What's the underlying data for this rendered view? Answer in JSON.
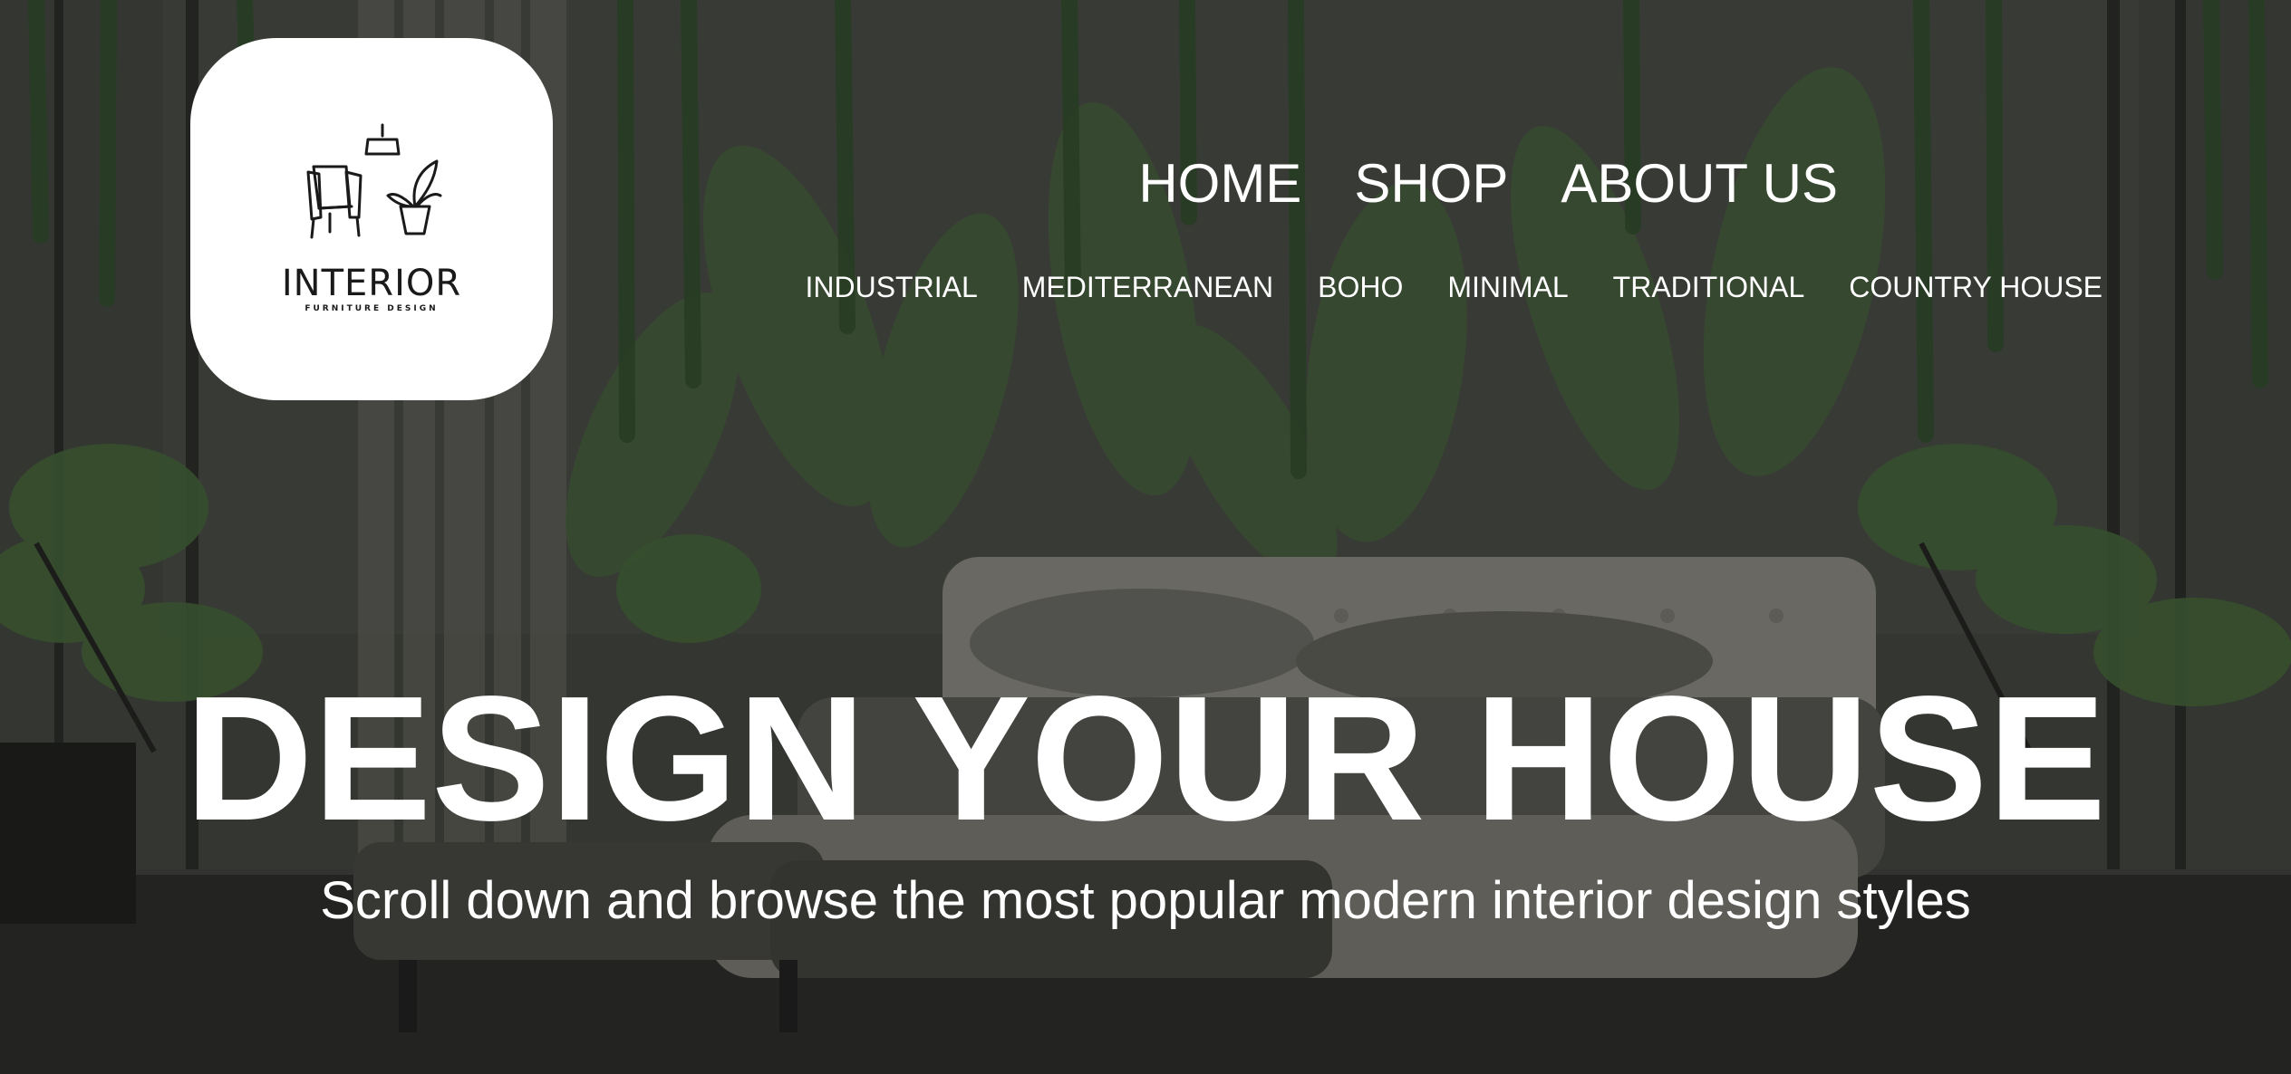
{
  "logo": {
    "name": "INTERIOR",
    "tagline": "FURNITURE DESIGN",
    "icon": "armchair-lamp-plant-icon"
  },
  "main_nav": [
    {
      "label": "HOME"
    },
    {
      "label": "SHOP"
    },
    {
      "label": "ABOUT US"
    }
  ],
  "style_nav": [
    {
      "label": "INDUSTRIAL"
    },
    {
      "label": "MEDITERRANEAN"
    },
    {
      "label": "BOHO"
    },
    {
      "label": "MINIMAL"
    },
    {
      "label": "TRADITIONAL"
    },
    {
      "label": "COUNTRY HOUSE"
    }
  ],
  "hero": {
    "headline": "DESIGN YOUR HOUSE",
    "subheadline": "Scroll down and browse the most popular modern interior design styles",
    "background": "dark bedroom with tufted bed and tropical plants"
  },
  "colors": {
    "text": "#ffffff",
    "logo_card": "#ffffff",
    "overlay": "#2e302c",
    "foliage": "#3f5a35"
  }
}
